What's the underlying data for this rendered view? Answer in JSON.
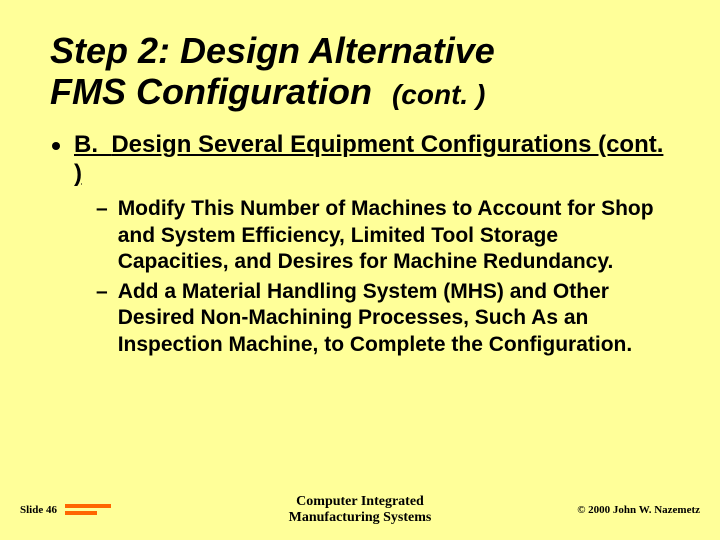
{
  "title": {
    "line1": "Step 2: Design Alternative",
    "line2": "FMS Configuration",
    "cont": "(cont. )"
  },
  "main_bullet": {
    "letter": "B.",
    "text": "Design Several Equipment Configurations (cont. )"
  },
  "sub_bullets": [
    "Modify This Number of Machines to Account for Shop and System Efficiency, Limited Tool Storage Capacities, and Desires for Machine Redundancy.",
    "Add a Material Handling System (MHS) and Other Desired Non-Machining Processes, Such As an Inspection Machine, to Complete the Configuration."
  ],
  "footer": {
    "slide_label": "Slide 46",
    "center_line1": "Computer Integrated",
    "center_line2": "Manufacturing Systems",
    "copyright": "© 2000 John W. Nazemetz"
  }
}
